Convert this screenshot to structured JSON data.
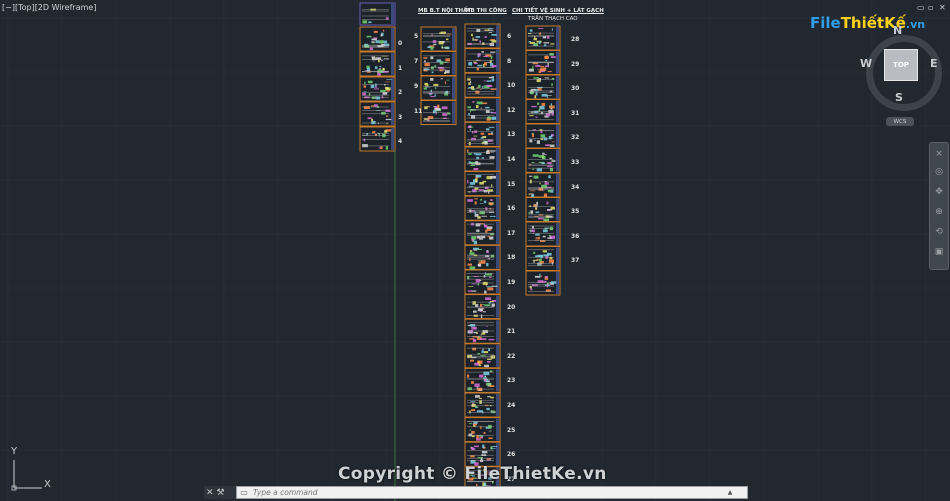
{
  "viewport": {
    "label": "[−][Top][2D Wireframe]",
    "window_controls": [
      "▭",
      "▫",
      "✕"
    ]
  },
  "drawing": {
    "col_noithat_title": "MB B.T NỘI THẤT",
    "col_thicong_title": "MB THI CÔNG",
    "col_chitiet_title": "CHI TIẾT VỆ SINH + LÁT GẠCH",
    "col_chitiet_subtitle": "TRẦN THẠCH CAO",
    "col0_numbers": [
      "0",
      "1",
      "2",
      "3",
      "4"
    ],
    "col1_numbers": [
      "5",
      "7",
      "9",
      "11"
    ],
    "col2_numbers": [
      "6",
      "8",
      "10",
      "12",
      "13",
      "14",
      "15",
      "16",
      "17",
      "18",
      "19",
      "20",
      "21",
      "22",
      "23",
      "24",
      "25",
      "26",
      "27"
    ],
    "col3_numbers": [
      "28",
      "29",
      "30",
      "31",
      "32",
      "33",
      "34",
      "35",
      "36",
      "37"
    ]
  },
  "viewcube": {
    "face_label": "TOP",
    "north": "N",
    "south": "S",
    "east": "E",
    "west": "W",
    "wcs_label": "WCS"
  },
  "ucs": {
    "x_label": "X",
    "y_label": "Y"
  },
  "logo": {
    "part1": "File",
    "part2": "ThiếtKế",
    "part3": ".vn"
  },
  "command": {
    "placeholder": "Type a command",
    "close_label": "✕",
    "settings_label": "⚒",
    "prompt_icon": "▭",
    "history_arrow": "▲"
  },
  "watermark": "Copyright © FileThietKe.vn",
  "colors": {
    "background": "#212830",
    "sheet_frame": "#c87a2c",
    "sheet_frame_alt": "#6a5ab8",
    "viewcube_face": "#b9bdc2"
  }
}
